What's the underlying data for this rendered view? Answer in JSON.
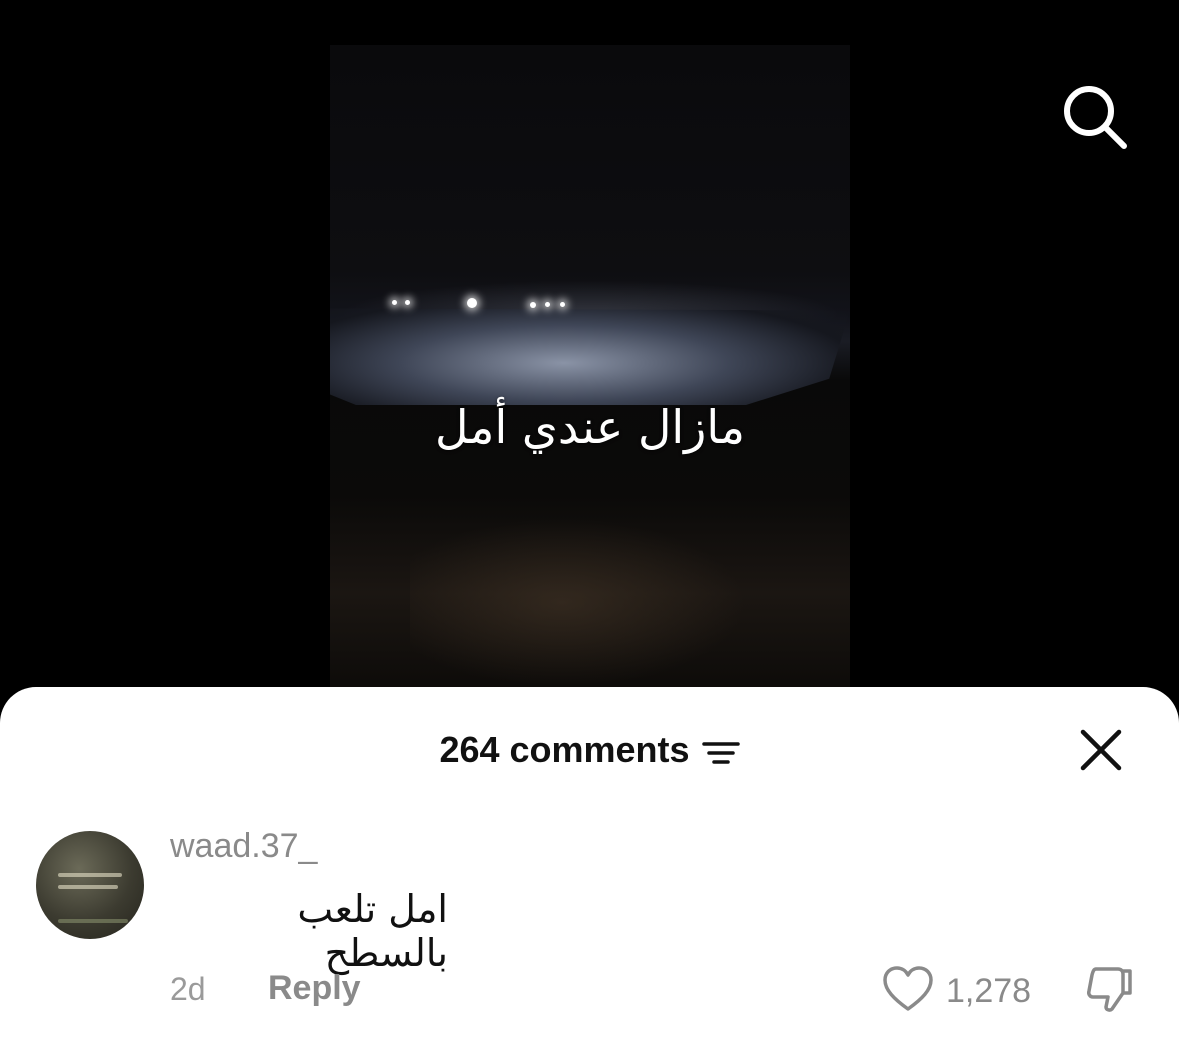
{
  "video": {
    "overlay_text": "مازال عندي أمل"
  },
  "header": {
    "search_icon": "search-icon"
  },
  "sheet": {
    "comments_title": "264 comments",
    "filter_icon": "filter-lines-icon",
    "close_icon": "close-icon"
  },
  "comment": {
    "username": "waad.37_",
    "text": "امل تلعب بالسطح",
    "time": "2d",
    "reply_label": "Reply",
    "like_count": "1,278",
    "like_icon": "heart-outline-icon",
    "dislike_icon": "thumbs-down-icon"
  }
}
